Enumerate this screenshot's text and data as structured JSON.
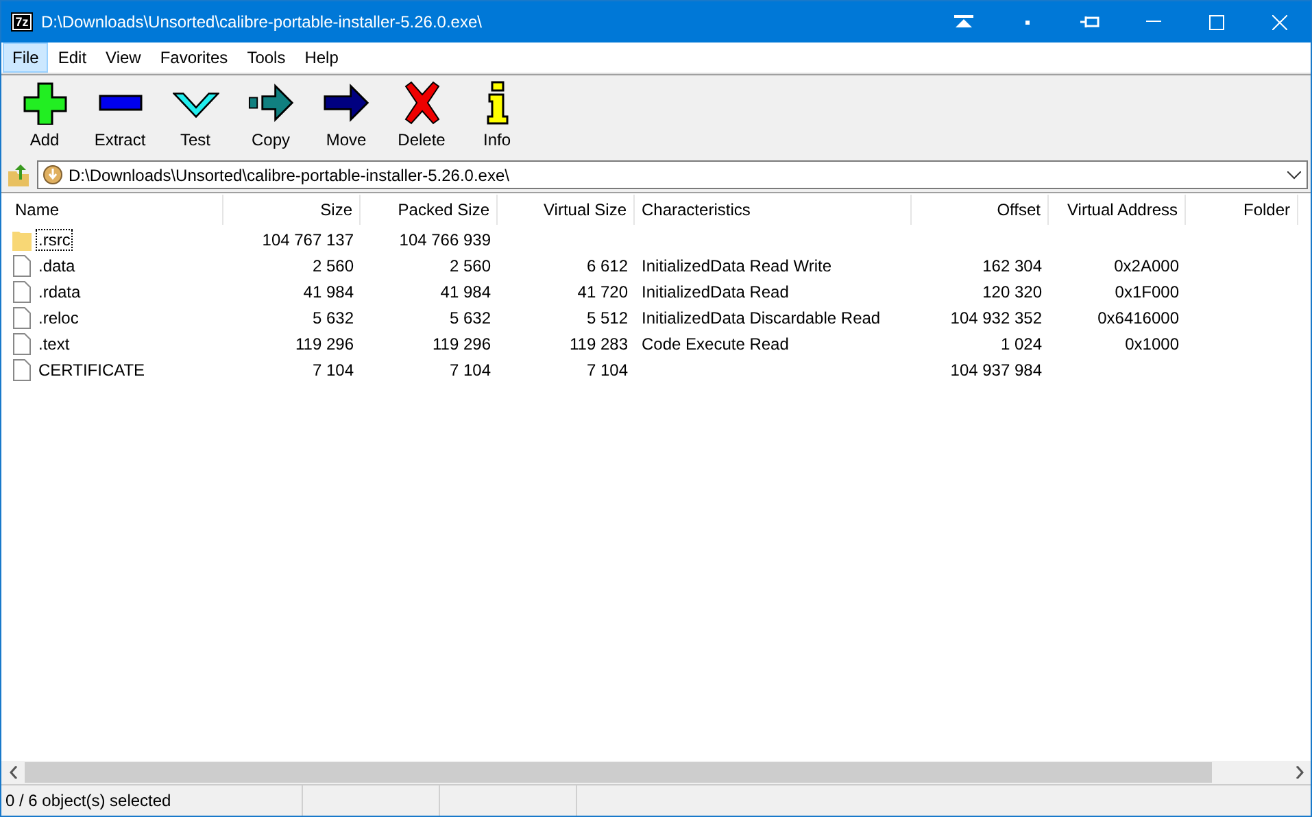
{
  "window": {
    "title": "D:\\Downloads\\Unsorted\\calibre-portable-installer-5.26.0.exe\\",
    "app_icon": "7z"
  },
  "menu": [
    {
      "label": "File",
      "selected": true
    },
    {
      "label": "Edit",
      "selected": false
    },
    {
      "label": "View",
      "selected": false
    },
    {
      "label": "Favorites",
      "selected": false
    },
    {
      "label": "Tools",
      "selected": false
    },
    {
      "label": "Help",
      "selected": false
    }
  ],
  "toolbar": [
    {
      "kind": "add",
      "label": "Add"
    },
    {
      "kind": "extract",
      "label": "Extract"
    },
    {
      "kind": "test",
      "label": "Test"
    },
    {
      "kind": "copy",
      "label": "Copy"
    },
    {
      "kind": "move",
      "label": "Move"
    },
    {
      "kind": "delete",
      "label": "Delete"
    },
    {
      "kind": "info",
      "label": "Info"
    }
  ],
  "address": {
    "value": "D:\\Downloads\\Unsorted\\calibre-portable-installer-5.26.0.exe\\"
  },
  "table": {
    "columns": [
      "Name",
      "Size",
      "Packed Size",
      "Virtual Size",
      "Characteristics",
      "Offset",
      "Virtual Address",
      "Folder"
    ],
    "rows": [
      {
        "kind": "folder",
        "focused": true,
        "cells": [
          ".rsrc",
          "104 767 137",
          "104 766 939",
          "",
          "",
          "",
          "",
          ""
        ]
      },
      {
        "kind": "file",
        "focused": false,
        "cells": [
          ".data",
          "2 560",
          "2 560",
          "6 612",
          "InitializedData Read Write",
          "162 304",
          "0x2A000",
          ""
        ]
      },
      {
        "kind": "file",
        "focused": false,
        "cells": [
          ".rdata",
          "41 984",
          "41 984",
          "41 720",
          "InitializedData Read",
          "120 320",
          "0x1F000",
          ""
        ]
      },
      {
        "kind": "file",
        "focused": false,
        "cells": [
          ".reloc",
          "5 632",
          "5 632",
          "5 512",
          "InitializedData Discardable Read",
          "104 932 352",
          "0x6416000",
          ""
        ]
      },
      {
        "kind": "file",
        "focused": false,
        "cells": [
          ".text",
          "119 296",
          "119 296",
          "119 283",
          "Code Execute Read",
          "1 024",
          "0x1000",
          ""
        ]
      },
      {
        "kind": "file",
        "focused": false,
        "cells": [
          "CERTIFICATE",
          "7 104",
          "7 104",
          "7 104",
          "",
          "104 937 984",
          "",
          ""
        ]
      }
    ]
  },
  "status_bar": [
    "0 / 6 object(s) selected"
  ]
}
